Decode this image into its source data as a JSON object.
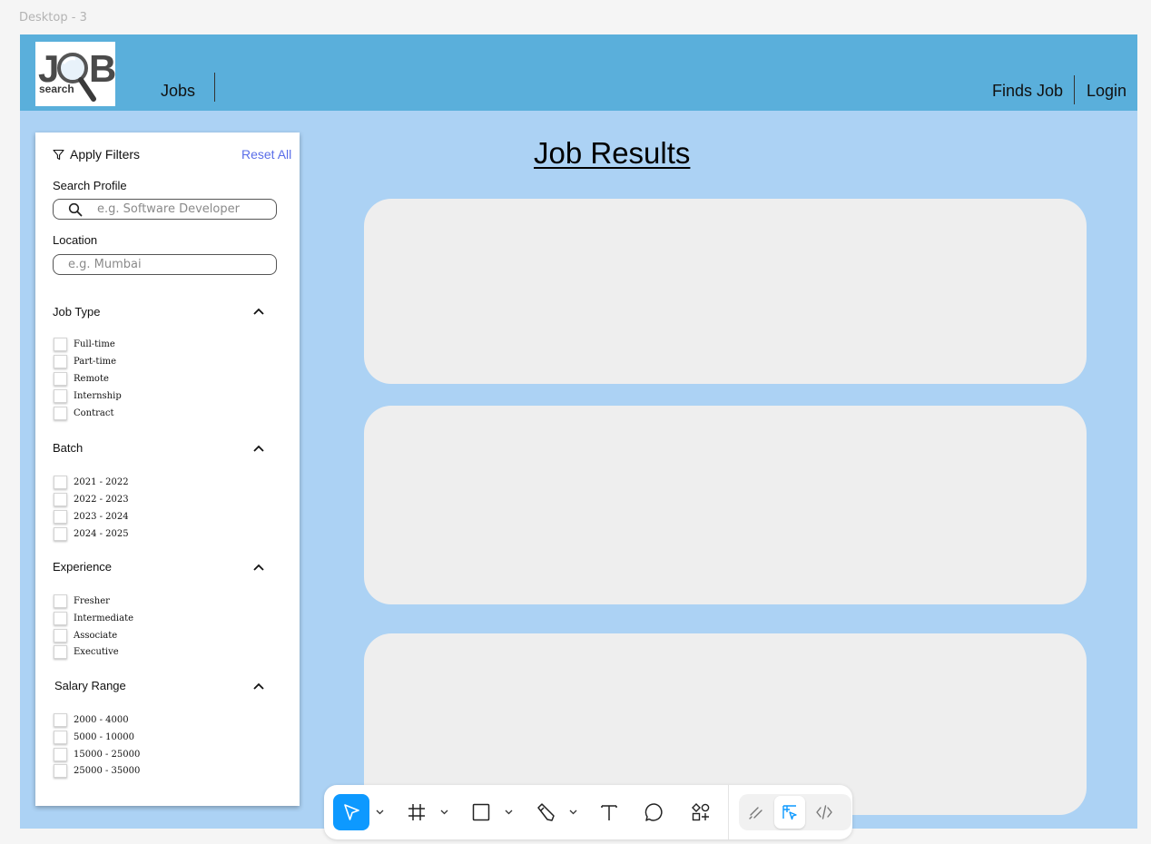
{
  "frame_label": "Desktop - 3",
  "logo": {
    "letters_top": "JOB",
    "letters_bottom": "search"
  },
  "nav": {
    "jobs": "Jobs",
    "finds_job": "Finds Job",
    "login": "Login"
  },
  "filters": {
    "apply_label": "Apply Filters",
    "reset_label": "Reset All",
    "search_profile_label": "Search Profile",
    "search_profile_placeholder": "e.g. Software Developer",
    "location_label": "Location",
    "location_placeholder": "e.g. Mumbai",
    "sections": [
      {
        "title": "Job Type",
        "options": [
          "Full-time",
          "Part-time",
          "Remote",
          "Internship",
          "Contract"
        ]
      },
      {
        "title": "Batch",
        "options": [
          "2021 - 2022",
          "2022 - 2023",
          "2023 - 2024",
          "2024 - 2025"
        ]
      },
      {
        "title": "Experience",
        "options": [
          "Fresher",
          "Intermediate",
          "Associate",
          "Executive"
        ]
      },
      {
        "title": "Salary Range",
        "options": [
          "2000 - 4000",
          "5000 - 10000",
          "15000 - 25000",
          "25000 - 35000"
        ]
      }
    ]
  },
  "results": {
    "title": "Job Results",
    "cards": 3
  },
  "toolbar": {
    "tools": [
      "move-icon",
      "frame-icon",
      "rectangle-icon",
      "pen-icon",
      "text-icon",
      "comment-icon",
      "components-icon",
      "draw-mode-icon",
      "design-mode-icon",
      "dev-mode-icon"
    ],
    "active_color": "#0d99ff"
  },
  "colors": {
    "navbar": "#5aafdb",
    "page": "#acd2f4",
    "card": "#eeeeee",
    "reset_link": "#5a6ee8"
  }
}
